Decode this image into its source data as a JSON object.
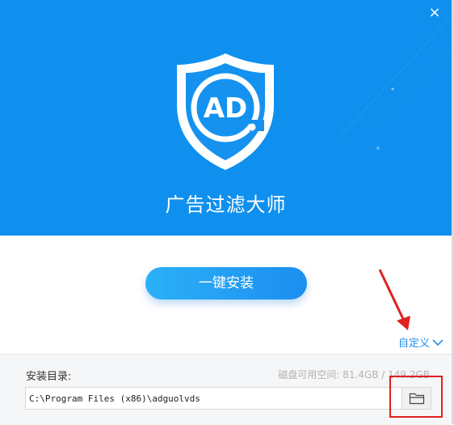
{
  "window": {
    "close_symbol": "×"
  },
  "header": {
    "logo_text": "AD",
    "title": "广告过滤大师"
  },
  "main": {
    "install_label": "一键安装",
    "customize_label": "自定义"
  },
  "footer": {
    "dir_label": "安装目录:",
    "disk_space": "磁盘可用空间: 81.4GB / 149.2GB",
    "install_path": "C:\\Program Files (x86)\\adguolvds"
  },
  "icons": {
    "close": "close-icon",
    "logo": "shield-ad-icon",
    "customize": "chevron-down-icon",
    "browse": "folder-icon"
  },
  "colors": {
    "header_bg": "#0f90ef",
    "accent": "#1f8ef0",
    "annotation": "#e02020"
  }
}
